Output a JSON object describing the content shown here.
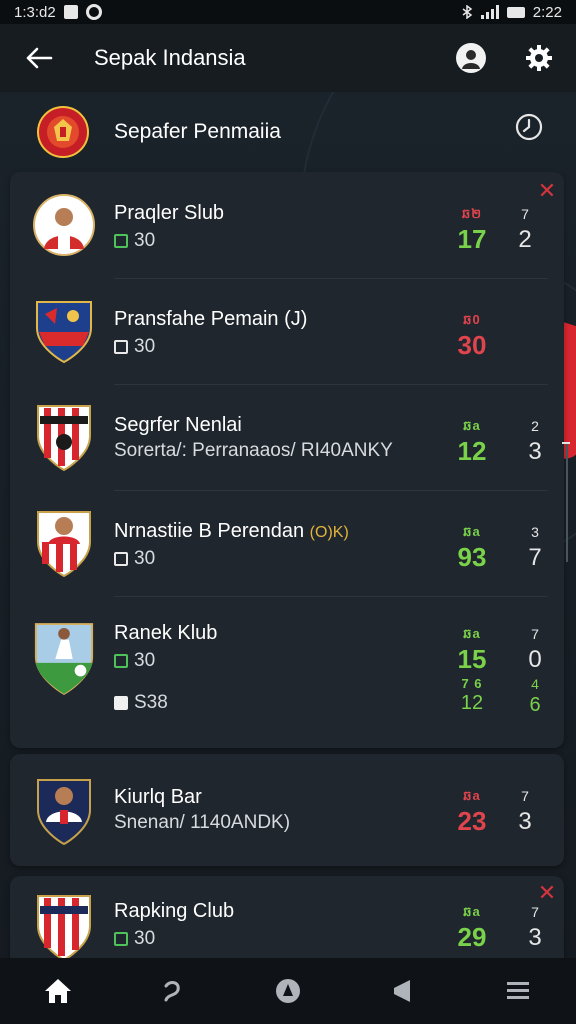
{
  "status_bar": {
    "time_left": "1:3:d2",
    "time_right": "2:22"
  },
  "app_bar": {
    "title": "Sepak Indansia",
    "back_icon": "arrow-left-icon",
    "avatar_icon": "avatar-icon",
    "settings_icon": "gear-icon"
  },
  "league": {
    "name": "Sepafer Penmaiia",
    "clock_icon": "clock-icon"
  },
  "clubs": [
    {
      "name": "Praqler Slub",
      "meta": "30",
      "meta_icon": "green-square-icon",
      "stat_head": "ឆ២",
      "stat_val": "17",
      "stat_color": "green",
      "rank_head": "7",
      "rank_val": "2"
    },
    {
      "name": "Pransfahe Pemain  (J)",
      "meta": "30",
      "meta_icon": "white-square-icon",
      "stat_head": "ឆ0",
      "stat_val": "30",
      "stat_color": "red",
      "rank_head": "",
      "rank_val": ""
    },
    {
      "name": "Segrfer Nenlai",
      "meta": "Sorerta/: Perranaaos/ RI40ANKY",
      "meta_icon": "",
      "stat_head": "ឆa",
      "stat_val": "12",
      "stat_color": "green",
      "rank_head": "2",
      "rank_val": "3"
    },
    {
      "name": "Nrnastiie B Perendan",
      "badge": "(O)K)",
      "meta": "30",
      "meta_icon": "white-square-icon",
      "stat_head": "ឆa",
      "stat_val": "93",
      "stat_color": "green",
      "rank_head": "3",
      "rank_val": "7"
    },
    {
      "name": "Ranek Klub",
      "meta": "30",
      "meta_icon": "green-square-icon",
      "meta2": "S38",
      "stat_head": "ឆa",
      "stat_val": "15",
      "stat_color": "green",
      "rank_head": "7",
      "rank_val": "0",
      "stat2_head": "7 6",
      "stat2_val": "12",
      "rank2_head": "4",
      "rank2_val": "6"
    },
    {
      "name": "Kiurlq Bar",
      "meta": "Snenan/ 1140ANDK)",
      "meta_icon": "",
      "stat_head": "ឆa",
      "stat_val": "23",
      "stat_color": "red",
      "rank_head": "7",
      "rank_val": "3"
    },
    {
      "name": "Rapking Club",
      "meta": "30",
      "meta_icon": "green-square-icon",
      "stat_head": "ឆa",
      "stat_val": "29",
      "stat_color": "green",
      "rank_head": "7",
      "rank_val": "3"
    }
  ],
  "bottom_nav": [
    {
      "label": "home",
      "icon": "home-icon"
    },
    {
      "label": "hook",
      "icon": "hook-icon"
    },
    {
      "label": "compass",
      "icon": "compass-icon"
    },
    {
      "label": "megaphone",
      "icon": "megaphone-icon"
    },
    {
      "label": "menu",
      "icon": "menu-icon"
    }
  ],
  "colors": {
    "accent_green": "#7ad14a",
    "accent_red": "#e0444c",
    "card_bg": "#1f262d"
  }
}
